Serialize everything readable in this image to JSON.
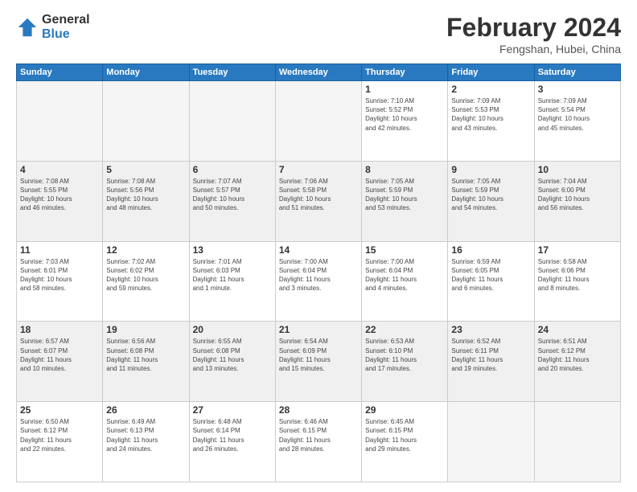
{
  "header": {
    "logo_line1": "General",
    "logo_line2": "Blue",
    "month": "February 2024",
    "location": "Fengshan, Hubei, China"
  },
  "weekdays": [
    "Sunday",
    "Monday",
    "Tuesday",
    "Wednesday",
    "Thursday",
    "Friday",
    "Saturday"
  ],
  "weeks": [
    [
      {
        "day": "",
        "info": ""
      },
      {
        "day": "",
        "info": ""
      },
      {
        "day": "",
        "info": ""
      },
      {
        "day": "",
        "info": ""
      },
      {
        "day": "1",
        "info": "Sunrise: 7:10 AM\nSunset: 5:52 PM\nDaylight: 10 hours\nand 42 minutes."
      },
      {
        "day": "2",
        "info": "Sunrise: 7:09 AM\nSunset: 5:53 PM\nDaylight: 10 hours\nand 43 minutes."
      },
      {
        "day": "3",
        "info": "Sunrise: 7:09 AM\nSunset: 5:54 PM\nDaylight: 10 hours\nand 45 minutes."
      }
    ],
    [
      {
        "day": "4",
        "info": "Sunrise: 7:08 AM\nSunset: 5:55 PM\nDaylight: 10 hours\nand 46 minutes."
      },
      {
        "day": "5",
        "info": "Sunrise: 7:08 AM\nSunset: 5:56 PM\nDaylight: 10 hours\nand 48 minutes."
      },
      {
        "day": "6",
        "info": "Sunrise: 7:07 AM\nSunset: 5:57 PM\nDaylight: 10 hours\nand 50 minutes."
      },
      {
        "day": "7",
        "info": "Sunrise: 7:06 AM\nSunset: 5:58 PM\nDaylight: 10 hours\nand 51 minutes."
      },
      {
        "day": "8",
        "info": "Sunrise: 7:05 AM\nSunset: 5:59 PM\nDaylight: 10 hours\nand 53 minutes."
      },
      {
        "day": "9",
        "info": "Sunrise: 7:05 AM\nSunset: 5:59 PM\nDaylight: 10 hours\nand 54 minutes."
      },
      {
        "day": "10",
        "info": "Sunrise: 7:04 AM\nSunset: 6:00 PM\nDaylight: 10 hours\nand 56 minutes."
      }
    ],
    [
      {
        "day": "11",
        "info": "Sunrise: 7:03 AM\nSunset: 6:01 PM\nDaylight: 10 hours\nand 58 minutes."
      },
      {
        "day": "12",
        "info": "Sunrise: 7:02 AM\nSunset: 6:02 PM\nDaylight: 10 hours\nand 59 minutes."
      },
      {
        "day": "13",
        "info": "Sunrise: 7:01 AM\nSunset: 6:03 PM\nDaylight: 11 hours\nand 1 minute."
      },
      {
        "day": "14",
        "info": "Sunrise: 7:00 AM\nSunset: 6:04 PM\nDaylight: 11 hours\nand 3 minutes."
      },
      {
        "day": "15",
        "info": "Sunrise: 7:00 AM\nSunset: 6:04 PM\nDaylight: 11 hours\nand 4 minutes."
      },
      {
        "day": "16",
        "info": "Sunrise: 6:59 AM\nSunset: 6:05 PM\nDaylight: 11 hours\nand 6 minutes."
      },
      {
        "day": "17",
        "info": "Sunrise: 6:58 AM\nSunset: 6:06 PM\nDaylight: 11 hours\nand 8 minutes."
      }
    ],
    [
      {
        "day": "18",
        "info": "Sunrise: 6:57 AM\nSunset: 6:07 PM\nDaylight: 11 hours\nand 10 minutes."
      },
      {
        "day": "19",
        "info": "Sunrise: 6:56 AM\nSunset: 6:08 PM\nDaylight: 11 hours\nand 11 minutes."
      },
      {
        "day": "20",
        "info": "Sunrise: 6:55 AM\nSunset: 6:08 PM\nDaylight: 11 hours\nand 13 minutes."
      },
      {
        "day": "21",
        "info": "Sunrise: 6:54 AM\nSunset: 6:09 PM\nDaylight: 11 hours\nand 15 minutes."
      },
      {
        "day": "22",
        "info": "Sunrise: 6:53 AM\nSunset: 6:10 PM\nDaylight: 11 hours\nand 17 minutes."
      },
      {
        "day": "23",
        "info": "Sunrise: 6:52 AM\nSunset: 6:11 PM\nDaylight: 11 hours\nand 19 minutes."
      },
      {
        "day": "24",
        "info": "Sunrise: 6:51 AM\nSunset: 6:12 PM\nDaylight: 11 hours\nand 20 minutes."
      }
    ],
    [
      {
        "day": "25",
        "info": "Sunrise: 6:50 AM\nSunset: 6:12 PM\nDaylight: 11 hours\nand 22 minutes."
      },
      {
        "day": "26",
        "info": "Sunrise: 6:49 AM\nSunset: 6:13 PM\nDaylight: 11 hours\nand 24 minutes."
      },
      {
        "day": "27",
        "info": "Sunrise: 6:48 AM\nSunset: 6:14 PM\nDaylight: 11 hours\nand 26 minutes."
      },
      {
        "day": "28",
        "info": "Sunrise: 6:46 AM\nSunset: 6:15 PM\nDaylight: 11 hours\nand 28 minutes."
      },
      {
        "day": "29",
        "info": "Sunrise: 6:45 AM\nSunset: 6:15 PM\nDaylight: 11 hours\nand 29 minutes."
      },
      {
        "day": "",
        "info": ""
      },
      {
        "day": "",
        "info": ""
      }
    ]
  ]
}
